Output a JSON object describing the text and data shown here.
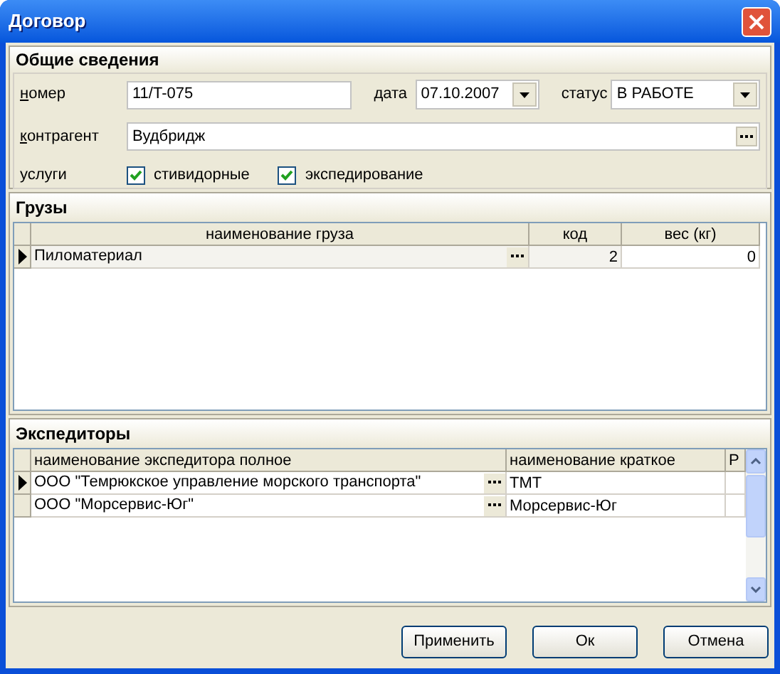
{
  "window": {
    "title": "Договор"
  },
  "general": {
    "title": "Общие сведения",
    "number": {
      "label": "номер",
      "mnemonic": true,
      "value": "11/T-075"
    },
    "date": {
      "label": "дата",
      "value": "07.10.2007"
    },
    "status": {
      "label": "статус",
      "value": "В РАБОТЕ"
    },
    "counterparty": {
      "label": "контрагент",
      "mnemonic": true,
      "value": "Вудбридж"
    },
    "services": {
      "label": "услуги",
      "options": [
        {
          "label": "стивидорные",
          "checked": true
        },
        {
          "label": "экспедирование",
          "checked": true
        }
      ]
    }
  },
  "cargo": {
    "title": "Грузы",
    "columns": [
      "наименование груза",
      "код",
      "вес (кг)"
    ],
    "rows": [
      {
        "current": true,
        "name": "Пиломатериал",
        "code": "2",
        "weight": "0"
      }
    ]
  },
  "forwarders": {
    "title": "Экспедиторы",
    "columns": [
      "наименование экспедитора полное",
      "наименование краткое",
      "Р"
    ],
    "rows": [
      {
        "current": true,
        "full_name": "ООО \"Темрюкское управление морского транспорта\"",
        "short_name": "ТМТ"
      },
      {
        "current": false,
        "full_name": "ООО \"Морсервис-Юг\"",
        "short_name": "Морсервис-Юг"
      }
    ]
  },
  "buttons": [
    "Применить",
    "Ок",
    "Отмена"
  ]
}
